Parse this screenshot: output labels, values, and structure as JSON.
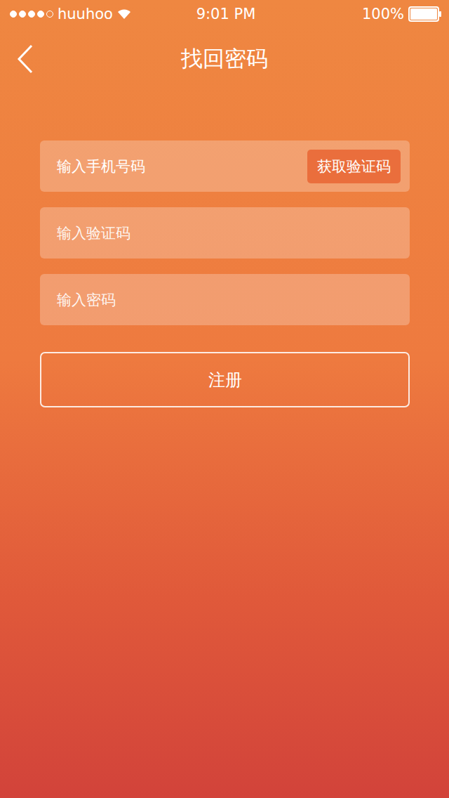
{
  "status_bar": {
    "signal": {
      "level": 0.8
    },
    "carrier": "huuhoo",
    "wifi": true,
    "time": "9:01 PM",
    "battery": {
      "reading": "100%",
      "level": 1
    }
  },
  "nav": {
    "title": "找回密码"
  },
  "form": {
    "fields": [
      {
        "placeholder": "输入手机号码",
        "kind": "phone",
        "action": "获取验证码"
      },
      {
        "placeholder": "输入验证码",
        "kind": "code",
        "action": ""
      },
      {
        "placeholder": "输入密码",
        "kind": "password",
        "action": ""
      }
    ],
    "submit": "注册"
  }
}
